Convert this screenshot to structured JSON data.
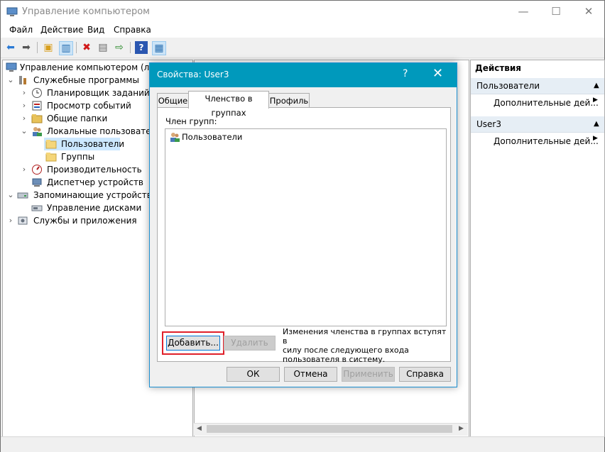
{
  "window": {
    "title": "Управление компьютером",
    "minimize": "—",
    "maximize": "☐",
    "close": "✕"
  },
  "menu": [
    "Файл",
    "Действие",
    "Вид",
    "Справка"
  ],
  "tree": {
    "root": "Управление компьютером (локал",
    "utilities": "Служебные программы",
    "task_scheduler": "Планировщик заданий",
    "event_viewer": "Просмотр событий",
    "shared_folders": "Общие папки",
    "local_users": "Локальные пользователи",
    "users": "Пользователи",
    "groups": "Группы",
    "performance": "Производительность",
    "device_manager": "Диспетчер устройств",
    "storage": "Запоминающие устройства",
    "disk_management": "Управление дисками",
    "services_apps": "Службы и приложения"
  },
  "actions": {
    "header": "Действия",
    "section1": "Пользователи",
    "section1_item": "Дополнительные дей...",
    "section2": "User3",
    "section2_item": "Дополнительные дей..."
  },
  "dialog": {
    "title": "Свойства: User3",
    "help_glyph": "?",
    "close_glyph": "✕",
    "tabs": [
      "Общие",
      "Членство в группах",
      "Профиль"
    ],
    "member_of_label": "Член групп:",
    "groups": [
      "Пользователи"
    ],
    "add_button": "Добавить...",
    "remove_button": "Удалить",
    "note_lines": [
      "Изменения членства в группах вступят в",
      "силу после следующего входа",
      "пользователя в систему."
    ],
    "ok": "ОК",
    "cancel": "Отмена",
    "apply": "Применить",
    "help": "Справка"
  },
  "colors": {
    "dialog_title_bg": "#0099bc",
    "selection": "#cce8ff",
    "highlight_box": "#e0202a"
  }
}
